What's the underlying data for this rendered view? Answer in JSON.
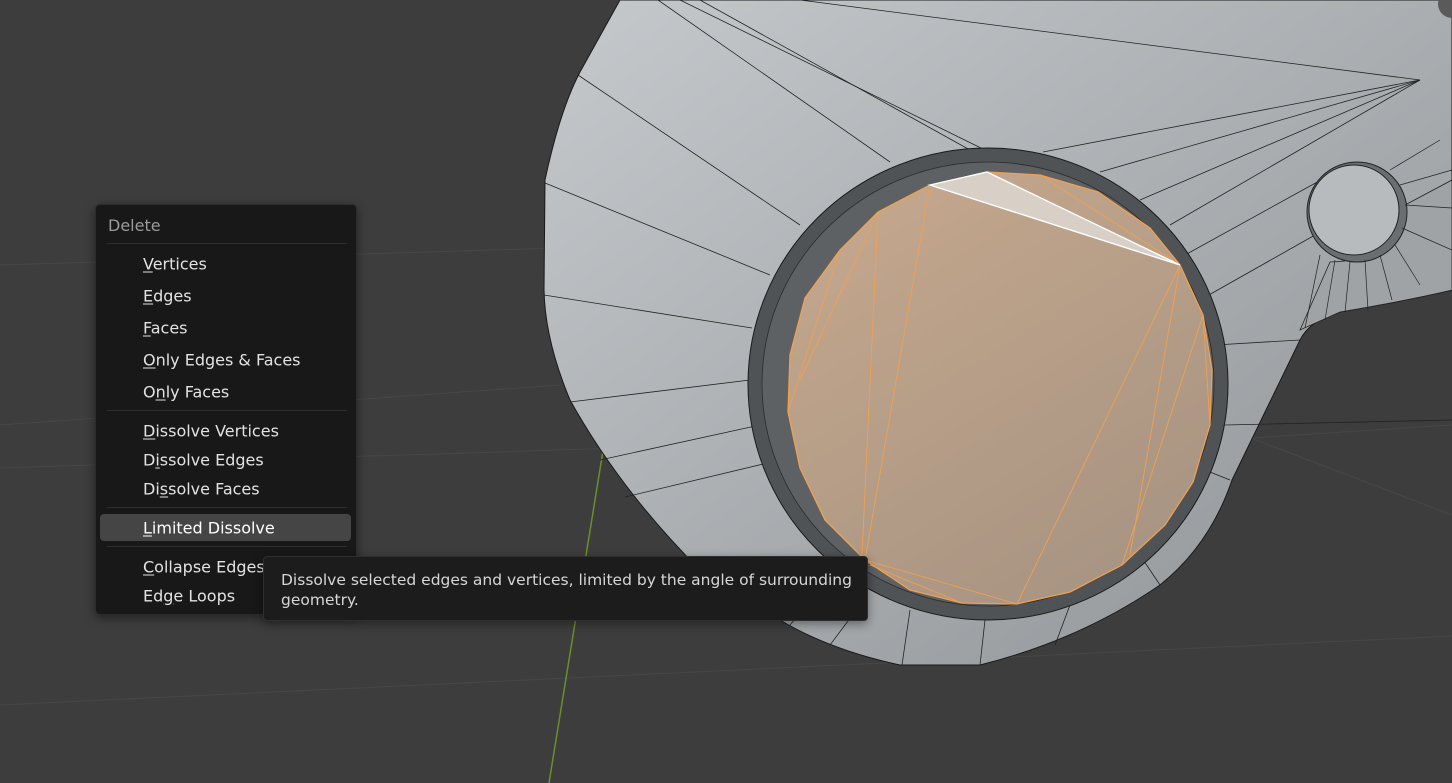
{
  "menu": {
    "title": "Delete",
    "items": [
      {
        "pre": "",
        "ul": "V",
        "post": "ertices"
      },
      {
        "pre": "",
        "ul": "E",
        "post": "dges"
      },
      {
        "pre": "",
        "ul": "F",
        "post": "aces"
      },
      {
        "pre": "",
        "ul": "O",
        "post": "nly Edges & Faces"
      },
      {
        "pre": "O",
        "ul": "n",
        "post": "ly Faces"
      },
      {
        "pre": "",
        "ul": "D",
        "post": "issolve Vertices"
      },
      {
        "pre": "D",
        "ul": "i",
        "post": "ssolve Edges"
      },
      {
        "pre": "Di",
        "ul": "s",
        "post": "solve Faces"
      },
      {
        "pre": "",
        "ul": "L",
        "post": "imited Dissolve"
      },
      {
        "pre": "",
        "ul": "C",
        "post": "ollapse Edges"
      },
      {
        "pre": "Ed",
        "ul": "g",
        "post": "e Loops"
      }
    ]
  },
  "tooltip": {
    "text": "Dissolve selected edges and vertices, limited by the angle of surrounding geometry."
  },
  "colors": {
    "background": "#3d3d3d",
    "mesh_face": "#a9adb1",
    "selection": "#f0a050",
    "menu_bg": "#181818",
    "menu_highlight": "#454545"
  }
}
